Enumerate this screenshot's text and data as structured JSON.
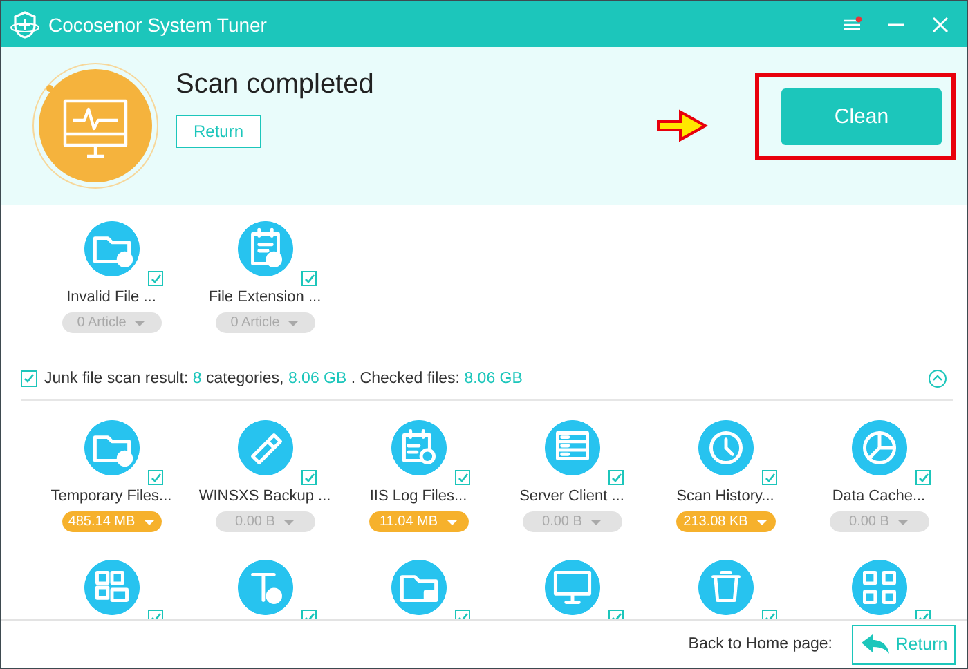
{
  "window": {
    "title": "Cocosenor System Tuner"
  },
  "header": {
    "status": "Scan completed",
    "return_button": "Return",
    "clean_button": "Clean"
  },
  "registry_items": [
    {
      "label": "Invalid File ...",
      "checked": true,
      "size": "0 Article",
      "highlighted": false
    },
    {
      "label": "File Extension ...",
      "checked": true,
      "size": "0 Article",
      "highlighted": false
    }
  ],
  "junk_summary": {
    "checked": true,
    "prefix": "Junk file scan result:",
    "categories": "8",
    "categories_suffix": "categories,",
    "size": "8.06 GB",
    "checked_label": ". Checked files:",
    "checked_size": "8.06 GB",
    "expanded": true
  },
  "junk_items": [
    {
      "label": "Temporary Files...",
      "checked": true,
      "size": "485.14 MB",
      "highlighted": true
    },
    {
      "label": "WINSXS Backup ...",
      "checked": true,
      "size": "0.00 B",
      "highlighted": false
    },
    {
      "label": "IIS Log Files...",
      "checked": true,
      "size": "11.04 MB",
      "highlighted": true
    },
    {
      "label": "Server Client ...",
      "checked": true,
      "size": "0.00 B",
      "highlighted": false
    },
    {
      "label": "Scan History...",
      "checked": true,
      "size": "213.08 KB",
      "highlighted": true
    },
    {
      "label": "Data Cache...",
      "checked": true,
      "size": "0.00 B",
      "highlighted": false
    },
    {
      "checked": true
    },
    {
      "checked": true
    },
    {
      "checked": true
    },
    {
      "checked": true
    },
    {
      "checked": true
    },
    {
      "checked": true
    }
  ],
  "footer": {
    "label": "Back to Home page:",
    "return_button": "Return"
  }
}
